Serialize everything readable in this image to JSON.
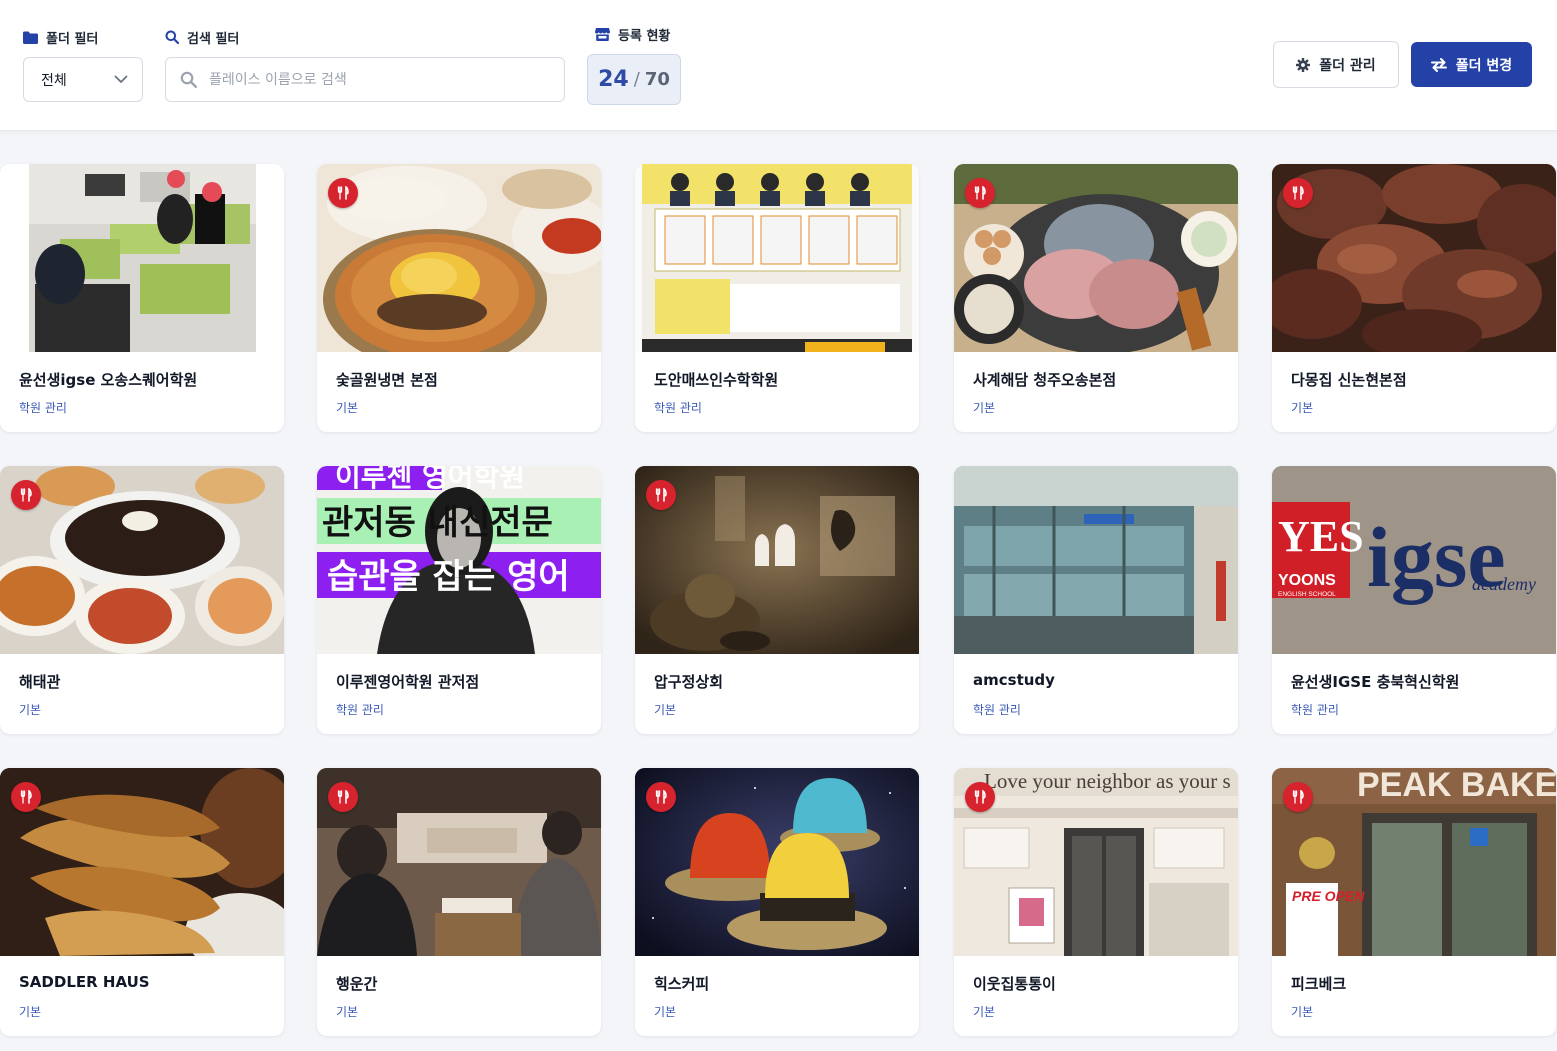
{
  "filters": {
    "folder_filter_label": "폴더 필터",
    "folder_filter_value": "전체",
    "search_filter_label": "검색 필터",
    "search_placeholder": "플레이스 이름으로 검색",
    "registration_label": "등록 현황",
    "registered_count": "24",
    "count_separator": "/",
    "registered_max": "70"
  },
  "actions": {
    "manage_folder_label": "폴더 관리",
    "change_folder_label": "폴더 변경"
  },
  "places": [
    {
      "name": "윤선생igse 오송스퀘어학원",
      "folder": "학원 관리"
    },
    {
      "name": "숯골원냉면 본점",
      "folder": "기본"
    },
    {
      "name": "도안매쓰인수학학원",
      "folder": "학원 관리"
    },
    {
      "name": "사계해담 청주오송본점",
      "folder": "기본"
    },
    {
      "name": "다몽집 신논현본점",
      "folder": "기본"
    },
    {
      "name": "해태관",
      "folder": "기본"
    },
    {
      "name": "이루젠영어학원 관저점",
      "folder": "학원 관리"
    },
    {
      "name": "압구정상회",
      "folder": "기본"
    },
    {
      "name": "amcstudy",
      "folder": "학원 관리"
    },
    {
      "name": "윤선생IGSE 충북혁신학원",
      "folder": "학원 관리"
    },
    {
      "name": "SADDLER HAUS",
      "folder": "기본"
    },
    {
      "name": "행운간",
      "folder": "기본"
    },
    {
      "name": "힉스커피",
      "folder": "기본"
    },
    {
      "name": "이웃집통통이",
      "folder": "기본"
    },
    {
      "name": "피크베크",
      "folder": "기본"
    }
  ],
  "thumbnail_text": {
    "irujen_line1": "이루젠 영어학원",
    "irujen_line2": "관저동 내신전문",
    "irujen_line3": "습관을 잡는 영어",
    "yoons_brand": "YOONS",
    "yoons_sub": "ENGLISH SCHOOL",
    "igse_brand": "igse",
    "igse_sub": "academy",
    "neighbor_sign": "Love your neighbor as your s",
    "peak_sign": "PEAK BAKE",
    "pre_open": "PRE OPEN"
  },
  "colors": {
    "primary": "#2441a8",
    "accent_blue": "#2d4aa6",
    "folder_link": "#3a59b5",
    "restaurant_badge": "#d7232e"
  },
  "icons": {
    "folder_filter": "folder-icon",
    "search_filter": "search-icon",
    "registration": "store-icon",
    "select": "chevron-down-icon",
    "manage": "gear-icon",
    "change": "swap-arrows-icon",
    "restaurant": "fork-knife-icon"
  }
}
